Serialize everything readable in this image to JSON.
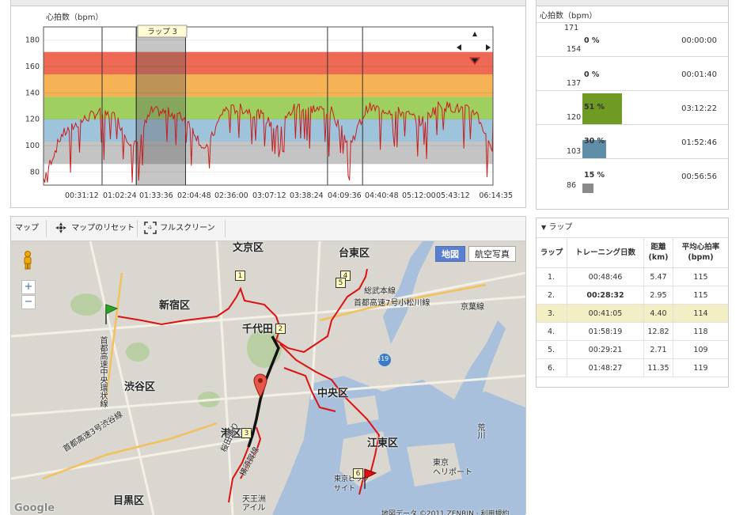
{
  "heart_rate": {
    "title": "心拍数（bpm）",
    "lap_label": "ラップ 3",
    "y_ticks": [
      "180",
      "160",
      "140",
      "120",
      "100",
      "80"
    ],
    "x_ticks": [
      "00:31:12",
      "01:02:24",
      "01:33:36",
      "02:04:48",
      "02:36:00",
      "03:07:12",
      "03:38:24",
      "04:09:36",
      "04:40:48",
      "05:12:00",
      "05:43:12",
      "06:14:35"
    ]
  },
  "chart_data": {
    "type": "line",
    "title": "心拍数（bpm）",
    "xlabel": "",
    "ylabel": "",
    "ylim": [
      70,
      190
    ],
    "x_ticks": [
      "00:31:12",
      "01:02:24",
      "01:33:36",
      "02:04:48",
      "02:36:00",
      "03:07:12",
      "03:38:24",
      "04:09:36",
      "04:40:48",
      "05:12:00",
      "05:43:12",
      "06:14:35"
    ],
    "zones": [
      {
        "from": 86,
        "to": 103,
        "color": "#c4c4c4"
      },
      {
        "from": 103,
        "to": 120,
        "color": "#9ec4dc"
      },
      {
        "from": 120,
        "to": 137,
        "color": "#9fcf5e"
      },
      {
        "from": 137,
        "to": 154,
        "color": "#f5b356"
      },
      {
        "from": 154,
        "to": 171,
        "color": "#ee6a55"
      }
    ],
    "lap_boundaries_minutes": [
      48.8,
      77.3,
      118.4,
      236.7,
      265.9,
      374.6
    ],
    "highlighted_lap": {
      "label": "ラップ 3",
      "start_minutes": 77.3,
      "end_minutes": 118.4
    },
    "series": [
      {
        "color": "#c81e1e",
        "sample_minutes_step": 15,
        "values": [
          75,
          108,
          118,
          125,
          122,
          98,
          126,
          125,
          120,
          95,
          127,
          128,
          124,
          112,
          130,
          128,
          126,
          100,
          129,
          127,
          125,
          118,
          131,
          128,
          126,
          96,
          122,
          126,
          118,
          90,
          127,
          123,
          121,
          116,
          128,
          126,
          124,
          120,
          87,
          126,
          121
        ]
      }
    ]
  },
  "zones_panel": {
    "title": "心拍数（bpm）",
    "top_value": "171",
    "rows": [
      {
        "bottom": "154",
        "pct": "0 %",
        "pct_value": 0,
        "time": "00:00:00",
        "color": "#ee6a55"
      },
      {
        "bottom": "137",
        "pct": "0 %",
        "pct_value": 0,
        "time": "00:01:40",
        "color": "#f5b356"
      },
      {
        "bottom": "120",
        "pct": "51 %",
        "pct_value": 51,
        "time": "03:12:22",
        "color": "#6f9a24"
      },
      {
        "bottom": "103",
        "pct": "30 %",
        "pct_value": 30,
        "time": "01:52:46",
        "color": "#5f8fa8"
      },
      {
        "bottom": "86",
        "pct": "15 %",
        "pct_value": 15,
        "time": "00:56:56",
        "color": "#8a8a8a"
      }
    ]
  },
  "map_toolbar": {
    "title": "マップ",
    "reset": "マップのリセット",
    "fullscreen": "フルスクリーン"
  },
  "map": {
    "btn_map": "地図",
    "btn_aerial": "航空写真",
    "zoom_in": "+",
    "zoom_out": "−",
    "labels": {
      "bunkyo": "文京区",
      "taito": "台東区",
      "shinjuku": "新宿区",
      "chiyoda": "千代田",
      "shibuya": "渋谷区",
      "chuo": "中央区",
      "minato": "港区",
      "koto": "江東区",
      "meguro": "目黒区",
      "sobu": "総武本線",
      "shuto7": "首都高速7号小松川線",
      "keiyo": "京葉線",
      "shutochuo": "首都高速中央環状線",
      "shuto3": "首都高速3号渋谷線",
      "sakurada": "桜田通り",
      "yokosuka": "横須賀線",
      "heliport": "東京\nヘリポート",
      "bigsight": "東京ビッグ\nサイト",
      "tennozu": "天王洲\nアイル",
      "route319": "319",
      "arakawa": "荒川",
      "google": "Google",
      "copyright": "地図データ ©2011 ZENRIN · 利用規約"
    },
    "lap_markers": [
      "1",
      "2",
      "3",
      "4",
      "5",
      "6"
    ]
  },
  "laps": {
    "title": "ラップ",
    "headers": [
      "ラップ",
      "トレーニング日数",
      "距離\n(km)",
      "平均心拍率\n(bpm)"
    ],
    "rows": [
      {
        "lap": "1.",
        "time": "00:48:46",
        "dist": "5.47",
        "hr": "115"
      },
      {
        "lap": "2.",
        "time": "00:28:32",
        "dist": "2.95",
        "hr": "115"
      },
      {
        "lap": "3.",
        "time": "00:41:05",
        "dist": "4.40",
        "hr": "114"
      },
      {
        "lap": "4.",
        "time": "01:58:19",
        "dist": "12.82",
        "hr": "118"
      },
      {
        "lap": "5.",
        "time": "00:29:21",
        "dist": "2.71",
        "hr": "109"
      },
      {
        "lap": "6.",
        "time": "01:48:27",
        "dist": "11.35",
        "hr": "119"
      }
    ]
  }
}
